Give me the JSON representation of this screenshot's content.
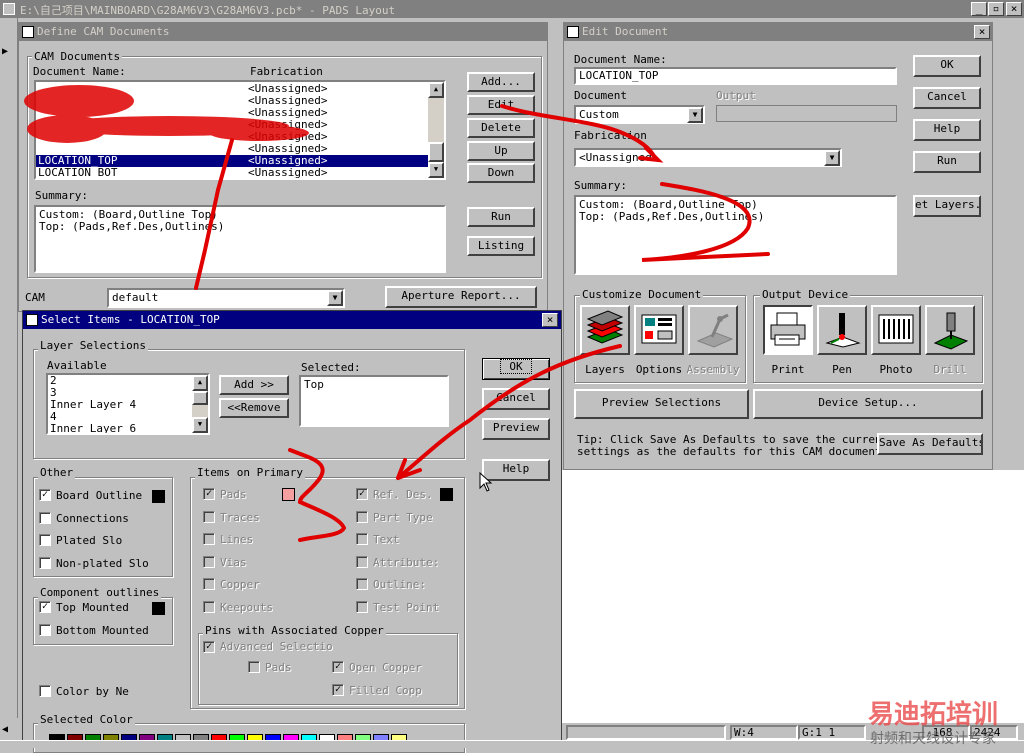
{
  "app": {
    "title": "E:\\自己项目\\MAINBOARD\\G28AM6V3\\G28AM6V3.pcb* - PADS Layout"
  },
  "define_cam": {
    "title": "Define CAM Documents",
    "group_cam_documents": "CAM Documents",
    "col_document_name": "Document Name:",
    "col_fabrication": "Fabrication",
    "rows": [
      {
        "name": "",
        "fab": "<Unassigned>"
      },
      {
        "name": "",
        "fab": "<Unassigned>"
      },
      {
        "name": "",
        "fab": "<Unassigned>"
      },
      {
        "name": "",
        "fab": "<Unassigned>"
      },
      {
        "name": "",
        "fab": "<Unassigned>"
      },
      {
        "name": "",
        "fab": "<Unassigned>"
      },
      {
        "name": "LOCATION_TOP",
        "fab": "<Unassigned>"
      },
      {
        "name": "LOCATION_BOT",
        "fab": "<Unassigned>"
      }
    ],
    "btn_add": "Add...",
    "btn_edit": "Edit",
    "btn_delete": "Delete",
    "btn_up": "Up",
    "btn_down": "Down",
    "summary_label": "Summary:",
    "summary_lines": [
      "Custom:  (Board,Outline Top)",
      "Top:  (Pads,Ref.Des,Outlines)"
    ],
    "btn_run": "Run",
    "btn_listing": "Listing",
    "cam_label": "CAM",
    "cam_value": "default",
    "btn_aperture": "Aperture Report..."
  },
  "edit_doc": {
    "title": "Edit Document",
    "docname_label": "Document Name:",
    "docname_value": "LOCATION_TOP",
    "document_label": "Document",
    "document_value": "Custom",
    "output_label": "Output",
    "fabrication_label": "Fabrication",
    "fabrication_value": "<Unassigned>",
    "summary_label": "Summary:",
    "summary_lines": [
      "Custom:  (Board,Outline Top)",
      "Top:  (Pads,Ref.Des,Outlines)"
    ],
    "btn_ok": "OK",
    "btn_cancel": "Cancel",
    "btn_help": "Help",
    "btn_run": "Run",
    "btn_layers": "et Layers...",
    "customize_label": "Customize Document",
    "tool_layers": "Layers",
    "tool_options": "Options",
    "tool_assembly": "Assembly",
    "output_device_label": "Output Device",
    "dev_print": "Print",
    "dev_pen": "Pen",
    "dev_photo": "Photo",
    "dev_drill": "Drill",
    "btn_preview": "Preview Selections",
    "btn_device_setup": "Device Setup...",
    "tip_line1": "Tip: Click Save As Defaults to save the current",
    "tip_line2": "settings as the defaults for this CAM document",
    "btn_save_defaults": "Save As Defaults"
  },
  "select_items": {
    "title": "Select Items - LOCATION_TOP",
    "layer_selections": "Layer Selections",
    "available_label": "Available",
    "available_items": [
      "2",
      "3",
      "Inner Layer 4",
      "4",
      "Inner Layer 6"
    ],
    "btn_add": "Add >>",
    "btn_remove": "<<Remove",
    "selected_label": "Selected:",
    "selected_items": [
      "Top"
    ],
    "btn_ok": "OK",
    "btn_cancel": "Cancel",
    "btn_preview": "Preview",
    "btn_help": "Help",
    "other_label": "Other",
    "other_items": [
      {
        "label": "Board Outline",
        "checked": true
      },
      {
        "label": "Connections",
        "checked": false
      },
      {
        "label": "Plated Slo",
        "checked": false
      },
      {
        "label": "Non-plated Slo",
        "checked": false
      }
    ],
    "comp_outlines_label": "Component outlines",
    "comp_items": [
      {
        "label": "Top Mounted",
        "checked": true
      },
      {
        "label": "Bottom Mounted",
        "checked": false
      }
    ],
    "color_by_net": "Color by Ne",
    "items_primary_label": "Items on Primary",
    "primary_left": [
      {
        "label": "Pads",
        "checked": true
      },
      {
        "label": "Traces",
        "checked": false
      },
      {
        "label": "Lines",
        "checked": false
      },
      {
        "label": "Vias",
        "checked": false
      },
      {
        "label": "Copper",
        "checked": false
      },
      {
        "label": "Keepouts",
        "checked": false
      }
    ],
    "primary_right": [
      {
        "label": "Ref. Des.",
        "checked": true
      },
      {
        "label": "Part Type",
        "checked": false
      },
      {
        "label": "Text",
        "checked": false
      },
      {
        "label": "Attribute:",
        "checked": false
      },
      {
        "label": "Outline:",
        "checked": false
      },
      {
        "label": "Test Point",
        "checked": false
      }
    ],
    "pins_label": "Pins with Associated Copper",
    "advanced_selection": "Advanced Selectio",
    "pins_pads": "Pads",
    "open_copper": "Open Copper",
    "filled_copper": "Filled Copp",
    "selected_color_label": "Selected Color",
    "color_pads": "#f4a0a0",
    "color_black": "#000000"
  },
  "status": {
    "w": "W:4",
    "g": "G:1 1",
    "x": "-168",
    "y": "2424"
  },
  "watermark": {
    "line1": "易迪拓培训",
    "line2": "射频和天线设计专家"
  },
  "palette": [
    "#000000",
    "#800000",
    "#008000",
    "#808000",
    "#000080",
    "#800080",
    "#008080",
    "#c0c0c0",
    "#808080",
    "#ff0000",
    "#00ff00",
    "#ffff00",
    "#0000ff",
    "#ff00ff",
    "#00ffff",
    "#ffffff",
    "#ff8080",
    "#80ff80",
    "#8080ff",
    "#ffff80"
  ]
}
